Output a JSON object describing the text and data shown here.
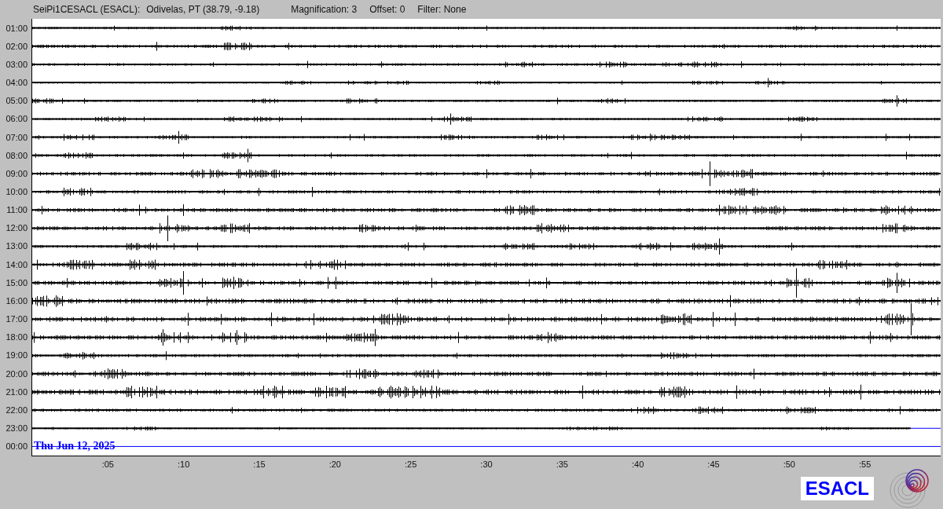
{
  "header": {
    "station": "SeiPi1CESACL (ESACL):",
    "location": "Odivelas, PT (38.79, -9.18)",
    "magnification": "Magnification: 3",
    "offset": "Offset: 0",
    "filter": "Filter: None"
  },
  "rows": [
    {
      "label": "01:00",
      "kind": "trace"
    },
    {
      "label": "02:00",
      "kind": "trace"
    },
    {
      "label": "03:00",
      "kind": "trace"
    },
    {
      "label": "04:00",
      "kind": "trace"
    },
    {
      "label": "05:00",
      "kind": "trace"
    },
    {
      "label": "06:00",
      "kind": "trace"
    },
    {
      "label": "07:00",
      "kind": "trace"
    },
    {
      "label": "08:00",
      "kind": "trace"
    },
    {
      "label": "09:00",
      "kind": "trace"
    },
    {
      "label": "10:00",
      "kind": "trace"
    },
    {
      "label": "11:00",
      "kind": "trace"
    },
    {
      "label": "12:00",
      "kind": "trace"
    },
    {
      "label": "13:00",
      "kind": "trace"
    },
    {
      "label": "14:00",
      "kind": "trace"
    },
    {
      "label": "15:00",
      "kind": "trace"
    },
    {
      "label": "16:00",
      "kind": "trace"
    },
    {
      "label": "17:00",
      "kind": "trace"
    },
    {
      "label": "18:00",
      "kind": "trace"
    },
    {
      "label": "19:00",
      "kind": "trace"
    },
    {
      "label": "20:00",
      "kind": "trace"
    },
    {
      "label": "21:00",
      "kind": "trace"
    },
    {
      "label": "22:00",
      "kind": "trace"
    },
    {
      "label": "23:00",
      "kind": "partial"
    },
    {
      "label": "00:00",
      "kind": "cursor"
    }
  ],
  "date": "Thu Jun 12, 2025",
  "minute_ticks": [
    ":05",
    ":10",
    ":15",
    ":20",
    ":25",
    ":30",
    ":35",
    ":40",
    ":45",
    ":50",
    ":55"
  ],
  "logo_text": "ESACL"
}
